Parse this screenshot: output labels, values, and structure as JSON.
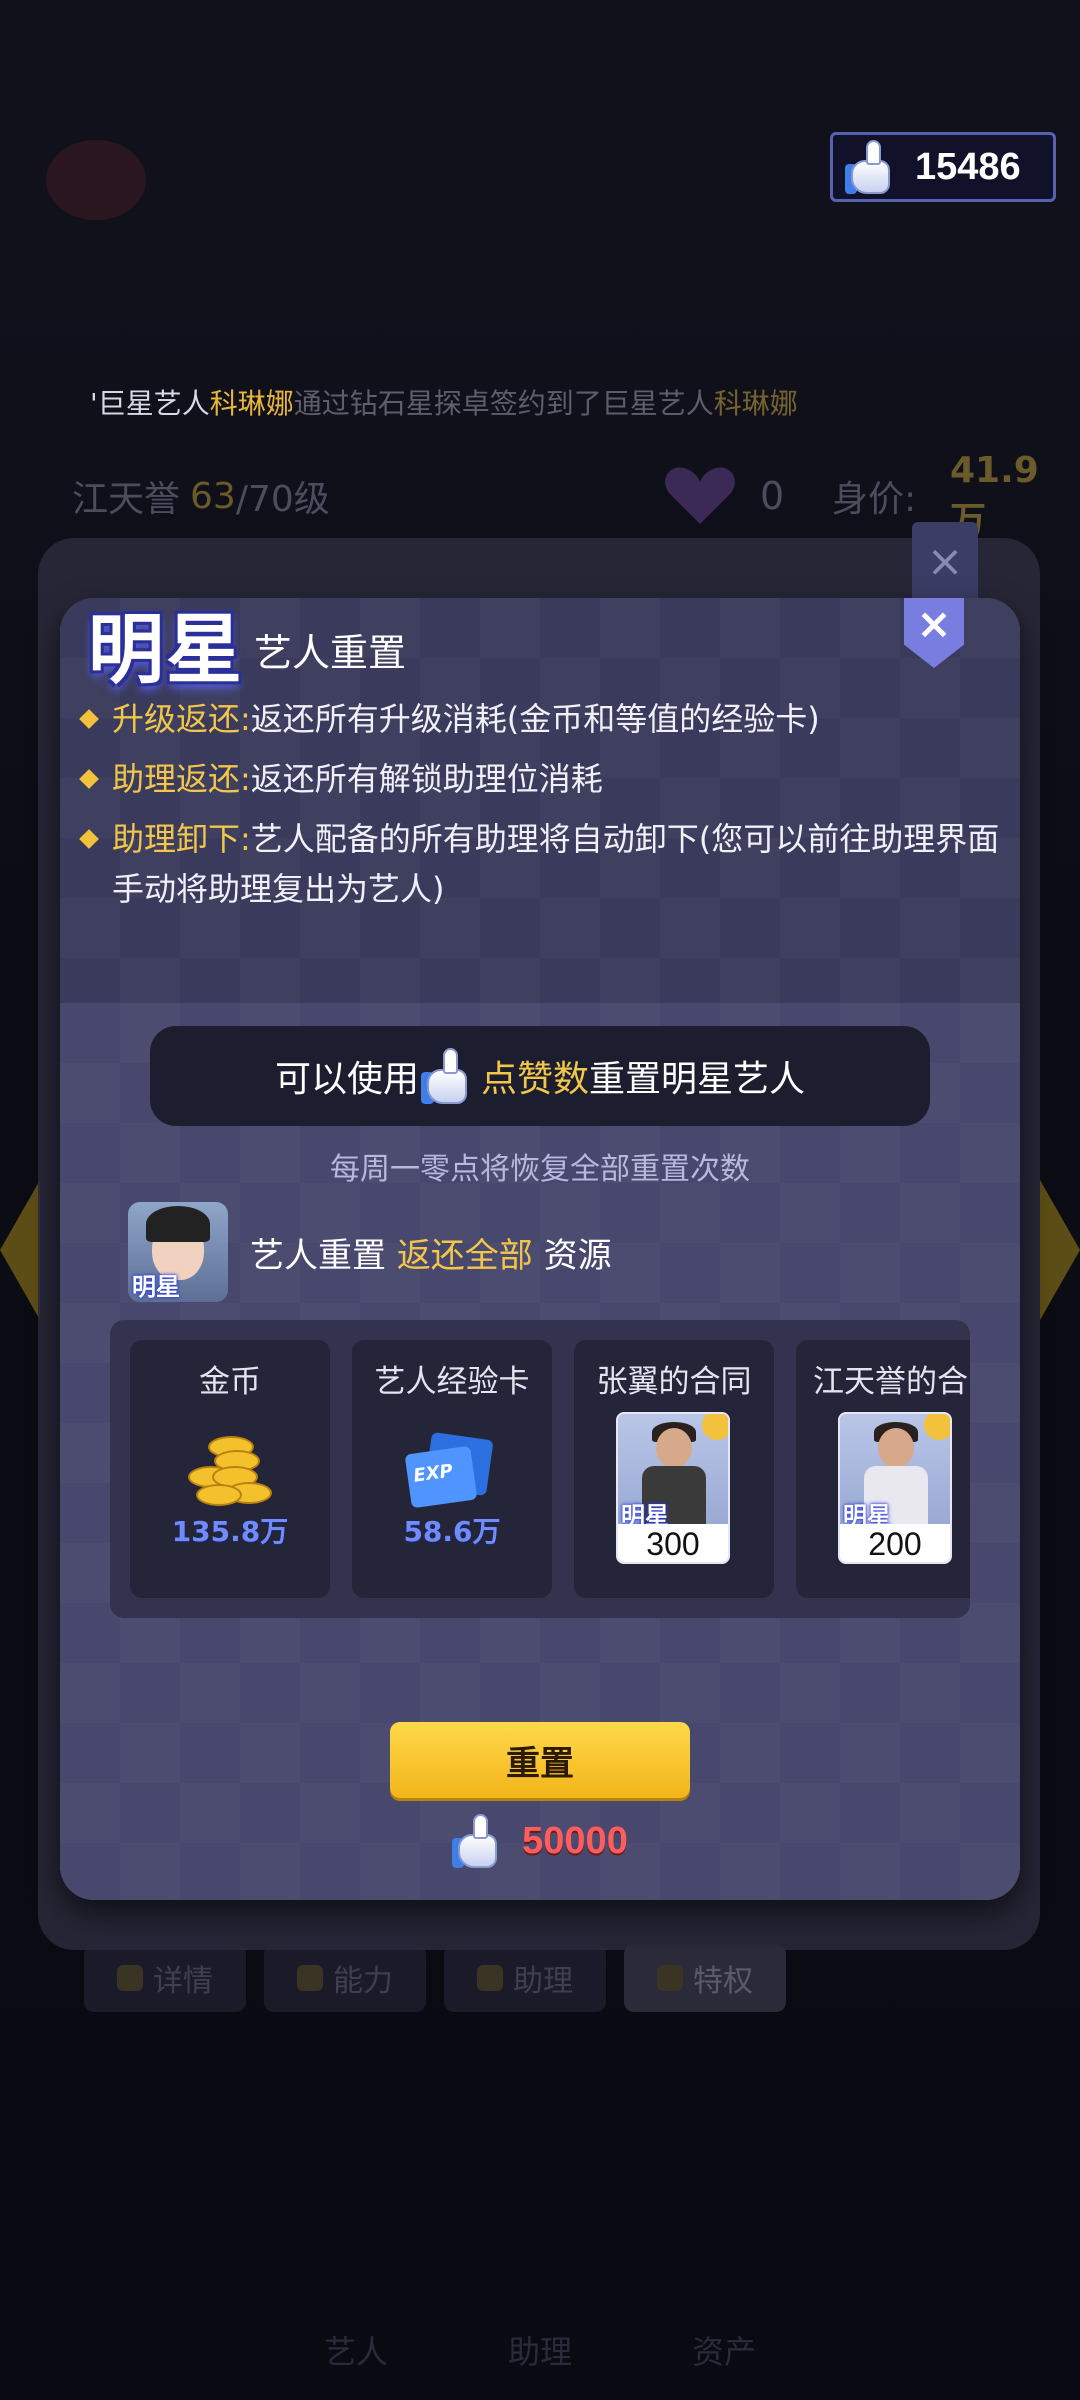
{
  "top_bar": {
    "like_count": "15486"
  },
  "background": {
    "marquee_prefix": "'巨星艺人",
    "marquee_name": "科琳娜",
    "marquee_rest": "通过钻石星探卓",
    "marquee_rest2": "签约到了巨星艺人",
    "marquee_name2": "科琳娜",
    "artist_name": "江天誉",
    "artist_level": "63",
    "artist_level_max": "/70级",
    "heart_count": "0",
    "price_label": "身价:",
    "price_value": "41.9万",
    "tabs": [
      {
        "label": "详情"
      },
      {
        "label": "能力"
      },
      {
        "label": "助理"
      },
      {
        "label": "特权"
      }
    ],
    "nav": [
      {
        "label": "艺人"
      },
      {
        "label": "助理"
      },
      {
        "label": "资产"
      }
    ]
  },
  "modal": {
    "badge": "明星",
    "title": "艺人重置",
    "close_symbol": "×",
    "rules": [
      {
        "label": "升级返还:",
        "text": "返还所有升级消耗(金币和等值的经验卡)"
      },
      {
        "label": "助理返还:",
        "text": "返还所有解锁助理位消耗"
      },
      {
        "label": "助理卸下:",
        "text": "艺人配备的所有助理将自动卸下(您可以前往助理界面手动将助理复出为艺人)"
      }
    ],
    "like_pill": {
      "prefix": "可以使用",
      "highlight": "点赞数",
      "suffix": "重置明星艺人"
    },
    "weekly_note": "每周一零点将恢复全部重置次数",
    "artist_row": {
      "avatar_tag": "明星",
      "prefix": "艺人重置 ",
      "highlight": "返还全部",
      "suffix": " 资源"
    },
    "resources": [
      {
        "name": "金币",
        "value": "135.8万",
        "icon": "gold-coins-icon"
      },
      {
        "name": "艺人经验卡",
        "value": "58.6万",
        "icon": "exp-card-icon",
        "icon_text": "EXP"
      },
      {
        "name": "张翼的合同",
        "value": "300",
        "tag": "明星",
        "icon": "contract-icon"
      },
      {
        "name": "江天誉的合同",
        "value": "200",
        "tag": "明星",
        "icon": "contract-icon"
      }
    ],
    "reset_button": "重置",
    "cost_value": "50000"
  }
}
